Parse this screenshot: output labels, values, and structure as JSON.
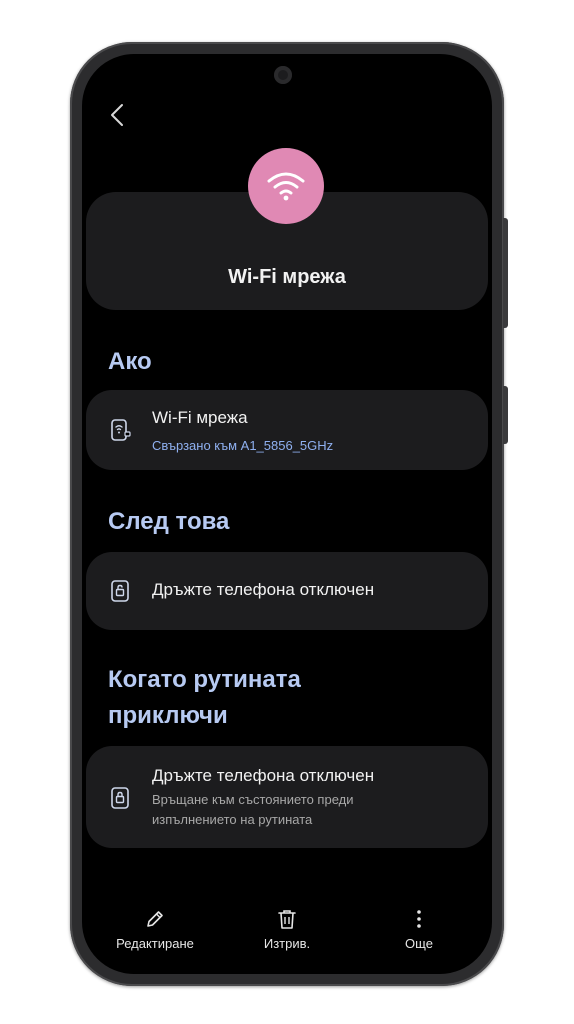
{
  "header": {
    "title": "Wi-Fi мрежа",
    "icon": "wifi-icon",
    "icon_bg_color": "#e089b4"
  },
  "sections": {
    "if_label": "Ако",
    "then_label": "След това",
    "when_done_label": "Когато рутината приключи"
  },
  "condition": {
    "icon": "wifi-device-icon",
    "title": "Wi-Fi мрежа",
    "subtitle": "Свързано към A1_5856_5GHz"
  },
  "action": {
    "icon": "unlock-icon",
    "title": "Дръжте телефона отключен"
  },
  "end_action": {
    "icon": "lock-icon",
    "title": "Дръжте телефона отключен",
    "subtitle": "Връщане към състоянието преди изпълнението на рутината"
  },
  "bottom_bar": {
    "edit_label": "Редактиране",
    "delete_label": "Изтрив.",
    "more_label": "Още"
  },
  "colors": {
    "accent_text": "#b7caf2",
    "link": "#8fb0f0",
    "card_bg": "#1c1c1e"
  }
}
